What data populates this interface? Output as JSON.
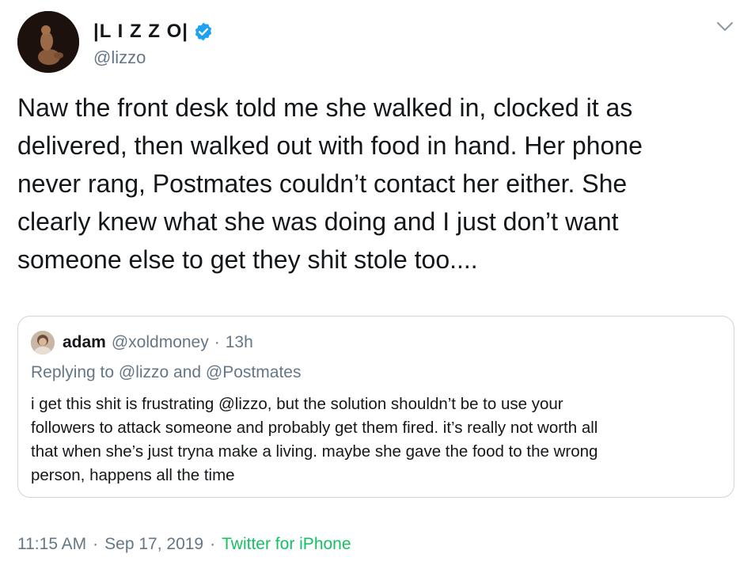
{
  "author": {
    "display_name": "|L I Z Z O|",
    "handle": "@lizzo",
    "verified": true
  },
  "tweet": {
    "text": "Naw the front desk told me she walked in, clocked it as\ndelivered, then walked out with food in hand. Her phone\nnever rang, Postmates couldn’t contact her either. She\nclearly knew what she was doing and I just don’t want\nsomeone else to get they shit stole too...."
  },
  "quoted_tweet": {
    "name": "adam",
    "handle": "@xoldmoney",
    "separator": "·",
    "time": "13h",
    "replying_to": "Replying to @lizzo and @Postmates",
    "text": "i get this shit is frustrating @lizzo, but the solution shouldn’t be to use your\nfollowers to attack someone and probably get them fired. it’s really not worth all\nthat when she’s just tryna make a living. maybe she gave the food to the wrong\nperson, happens all the time"
  },
  "meta": {
    "time": "11:15 AM",
    "separator": "·",
    "date": "Sep 17, 2019",
    "separator2": "·",
    "source": "Twitter for iPhone"
  },
  "icons": {
    "verified": "verified-badge-icon",
    "caret": "chevron-down-icon"
  },
  "colors": {
    "verified_blue": "#1da1f2",
    "source_green": "#17bf63",
    "secondary_text": "#657786",
    "border": "#ccd6dd"
  }
}
